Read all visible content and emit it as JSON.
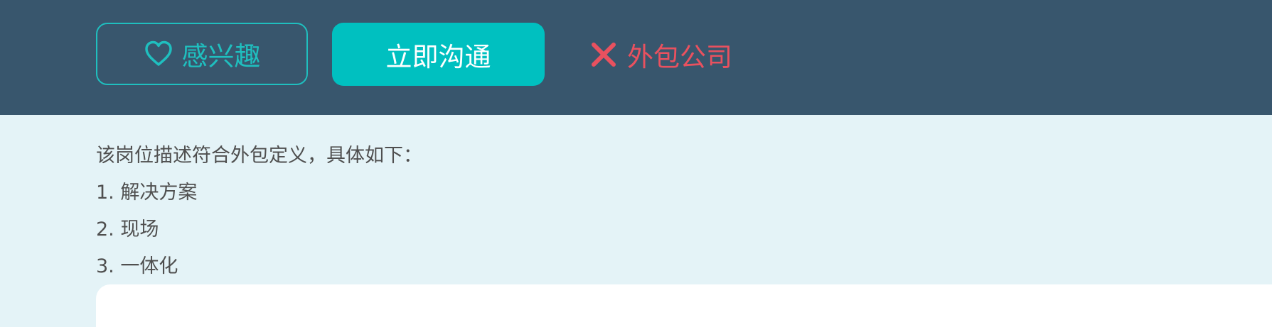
{
  "header": {
    "interest_label": "感兴趣",
    "contact_label": "立即沟通",
    "outsource_label": "外包公司"
  },
  "description": {
    "intro": "该岗位描述符合外包定义，具体如下：",
    "items": [
      "1. 解决方案",
      "2. 现场",
      "3. 一体化"
    ]
  },
  "icons": {
    "interest": "heart-icon",
    "outsource": "close-icon"
  },
  "colors": {
    "header_bg": "#38566d",
    "accent": "#00c0c0",
    "warning": "#e9515f",
    "content_bg": "#e4f3f7",
    "text": "#4f4f4f"
  }
}
